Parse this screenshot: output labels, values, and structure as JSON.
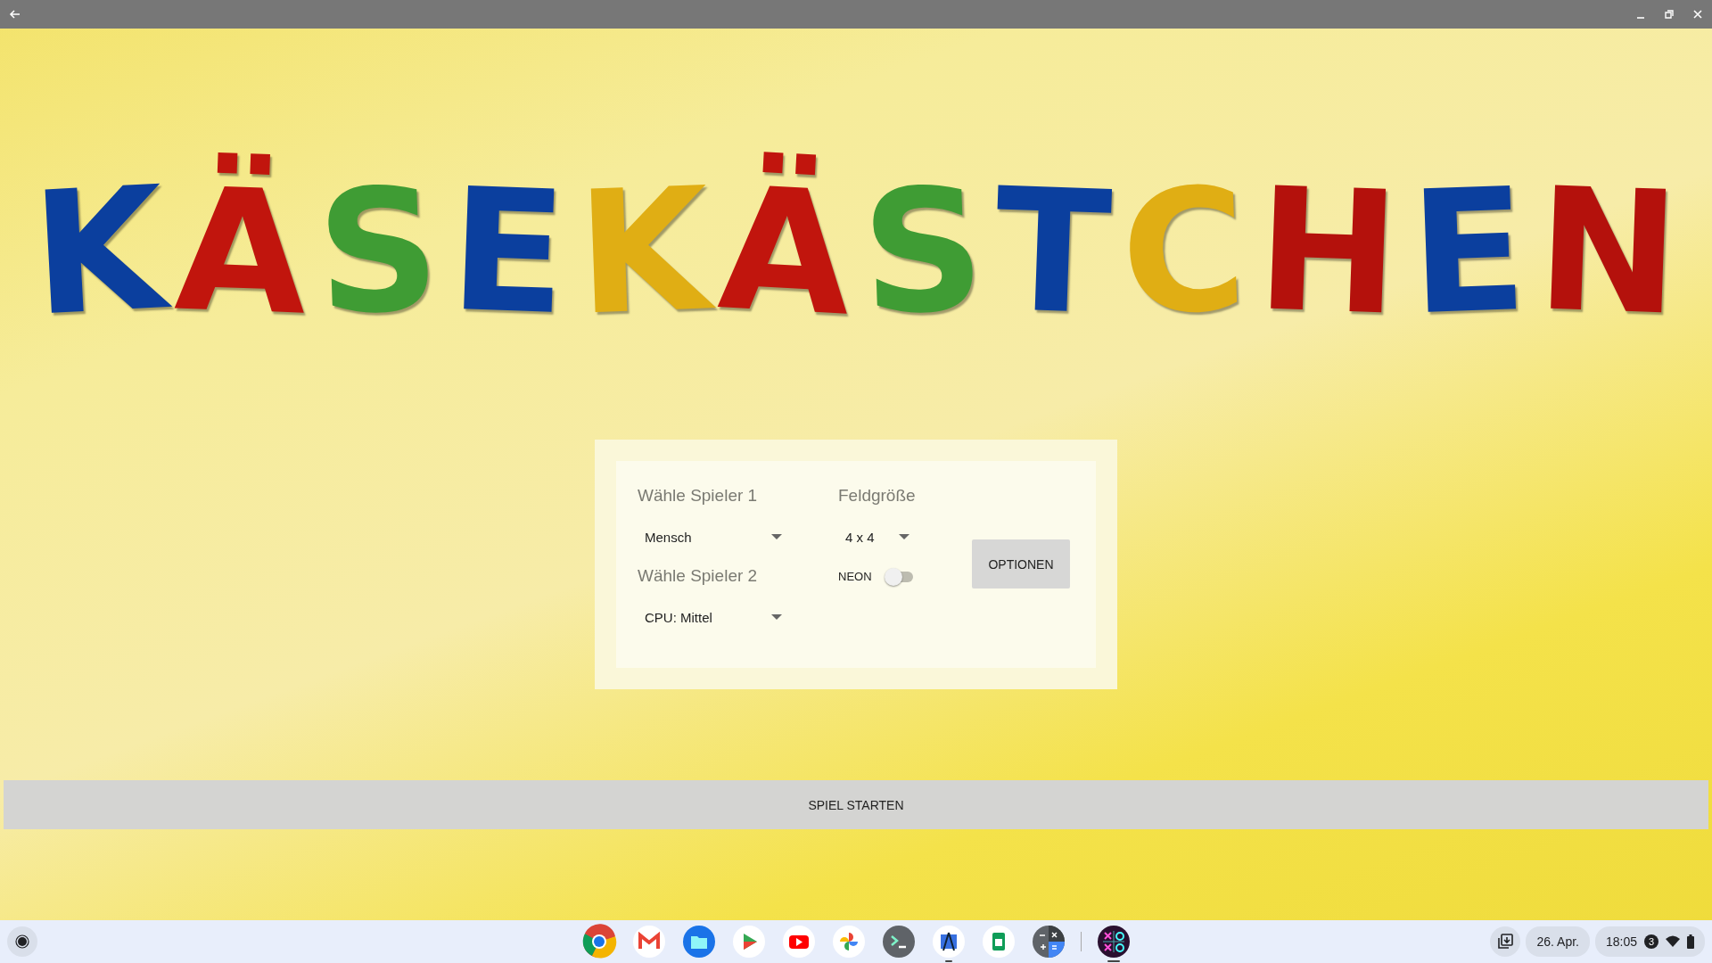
{
  "logo": {
    "letters": [
      {
        "char": "K",
        "color": "#0b3f9e"
      },
      {
        "char": "Ä",
        "color": "#c1150d"
      },
      {
        "char": "S",
        "color": "#3f9c34"
      },
      {
        "char": "E",
        "color": "#0b3f9e"
      },
      {
        "char": "K",
        "color": "#e0ae14"
      },
      {
        "char": "Ä",
        "color": "#c1150d"
      },
      {
        "char": "S",
        "color": "#3f9c34"
      },
      {
        "char": "T",
        "color": "#0b3f9e"
      },
      {
        "char": "C",
        "color": "#e0ae14"
      },
      {
        "char": "H",
        "color": "#b4110c"
      },
      {
        "char": "E",
        "color": "#0b3f9e"
      },
      {
        "char": "N",
        "color": "#b4110c"
      }
    ]
  },
  "setup": {
    "player1": {
      "label": "Wähle Spieler 1",
      "value": "Mensch"
    },
    "player2": {
      "label": "Wähle Spieler 2",
      "value": "CPU: Mittel"
    },
    "board_size": {
      "label": "Feldgröße",
      "value": "4 x 4"
    },
    "neon": {
      "label": "NEON",
      "on": false
    },
    "options_button": "OPTIONEN"
  },
  "start_button": "SPIEL STARTEN",
  "shelf": {
    "apps": [
      {
        "kind": "browser",
        "running": false
      },
      {
        "kind": "mail",
        "running": false
      },
      {
        "kind": "files",
        "running": false
      },
      {
        "kind": "store",
        "running": false
      },
      {
        "kind": "video",
        "running": false
      },
      {
        "kind": "photos",
        "running": false
      },
      {
        "kind": "terminal",
        "running": false
      },
      {
        "kind": "studio",
        "running": true
      },
      {
        "kind": "sheets",
        "running": false
      },
      {
        "kind": "calculator",
        "running": false
      },
      {
        "kind": "tictactoe",
        "running": true
      }
    ],
    "date": "26. Apr.",
    "time": "18:05",
    "notifications": "3"
  }
}
